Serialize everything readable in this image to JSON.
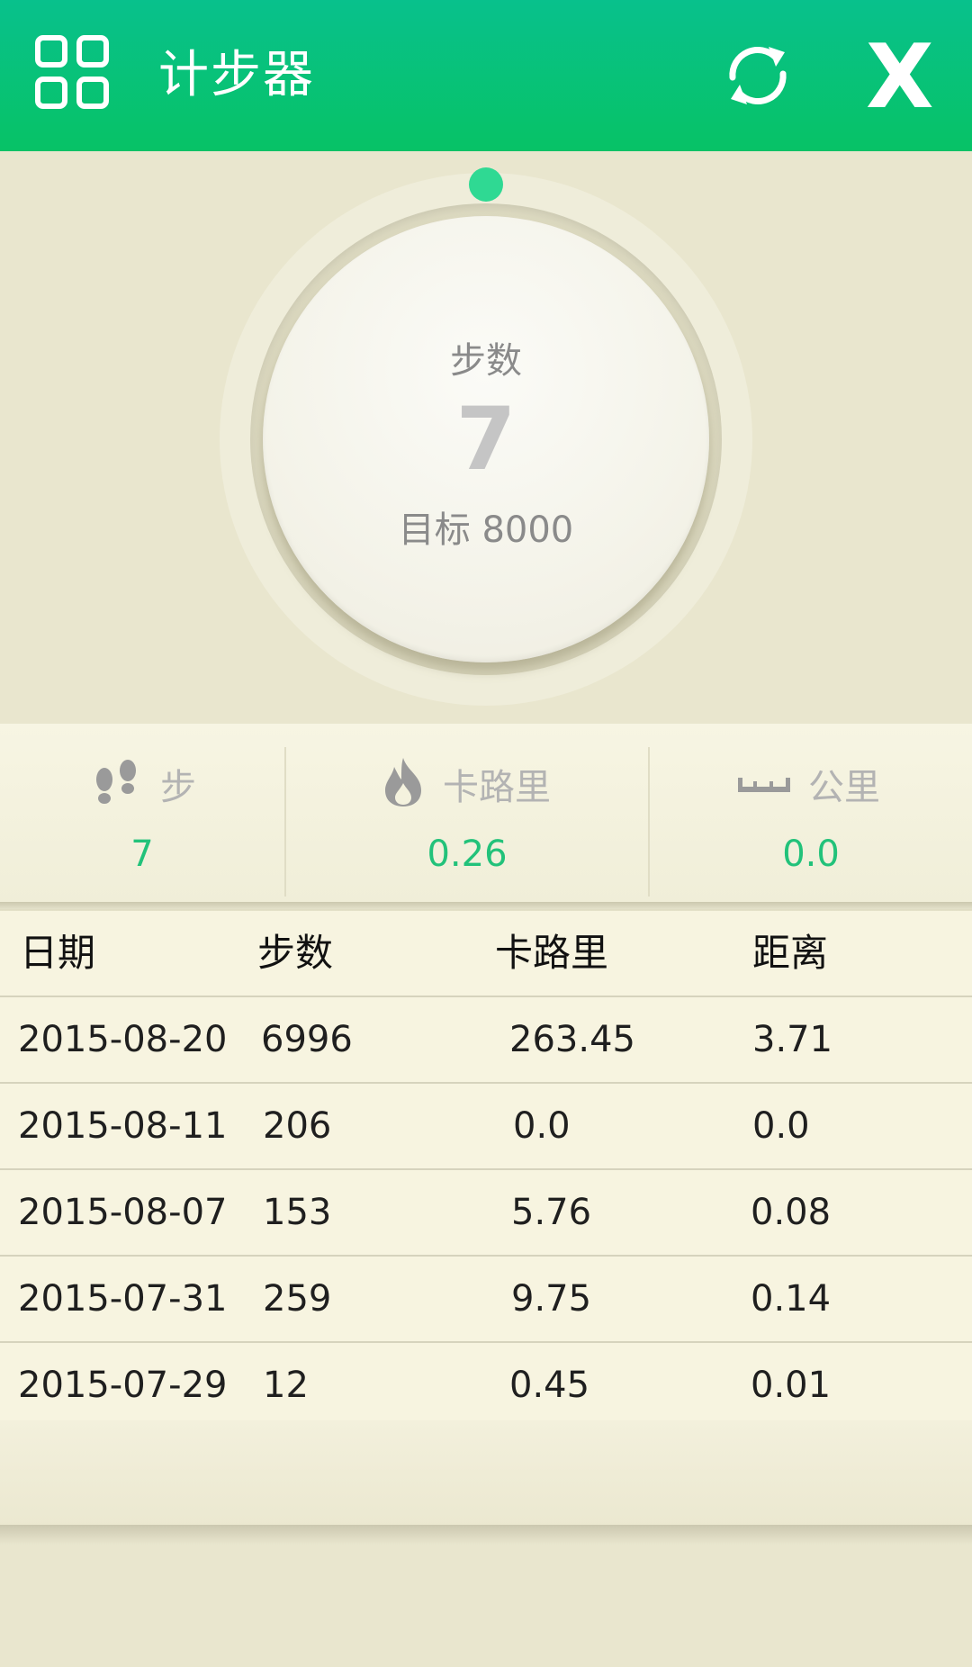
{
  "header": {
    "title": "计步器",
    "close_label": "X",
    "menu_icon": "grid-menu-icon",
    "refresh_icon": "refresh-icon"
  },
  "dial": {
    "label": "步数",
    "value": "7",
    "goal": "目标 8000",
    "accent_color": "#2fd993"
  },
  "stats": [
    {
      "icon": "footsteps-icon",
      "label": "步",
      "value": "7"
    },
    {
      "icon": "flame-icon",
      "label": "卡路里",
      "value": "0.26"
    },
    {
      "icon": "ruler-icon",
      "label": "公里",
      "value": "0.0"
    }
  ],
  "table": {
    "headers": [
      "日期",
      "步数",
      "卡路里",
      "距离"
    ],
    "rows": [
      [
        "2015-08-20",
        "6996",
        "263.45",
        "3.71"
      ],
      [
        "2015-08-11",
        "206",
        "0.0",
        "0.0"
      ],
      [
        "2015-08-07",
        "153",
        "5.76",
        "0.08"
      ],
      [
        "2015-07-31",
        "259",
        "9.75",
        "0.14"
      ],
      [
        "2015-07-29",
        "12",
        "0.45",
        "0.01"
      ]
    ]
  },
  "colors": {
    "header_green": "#07c266",
    "value_green": "#22c27a",
    "background": "#e9e6ce"
  }
}
